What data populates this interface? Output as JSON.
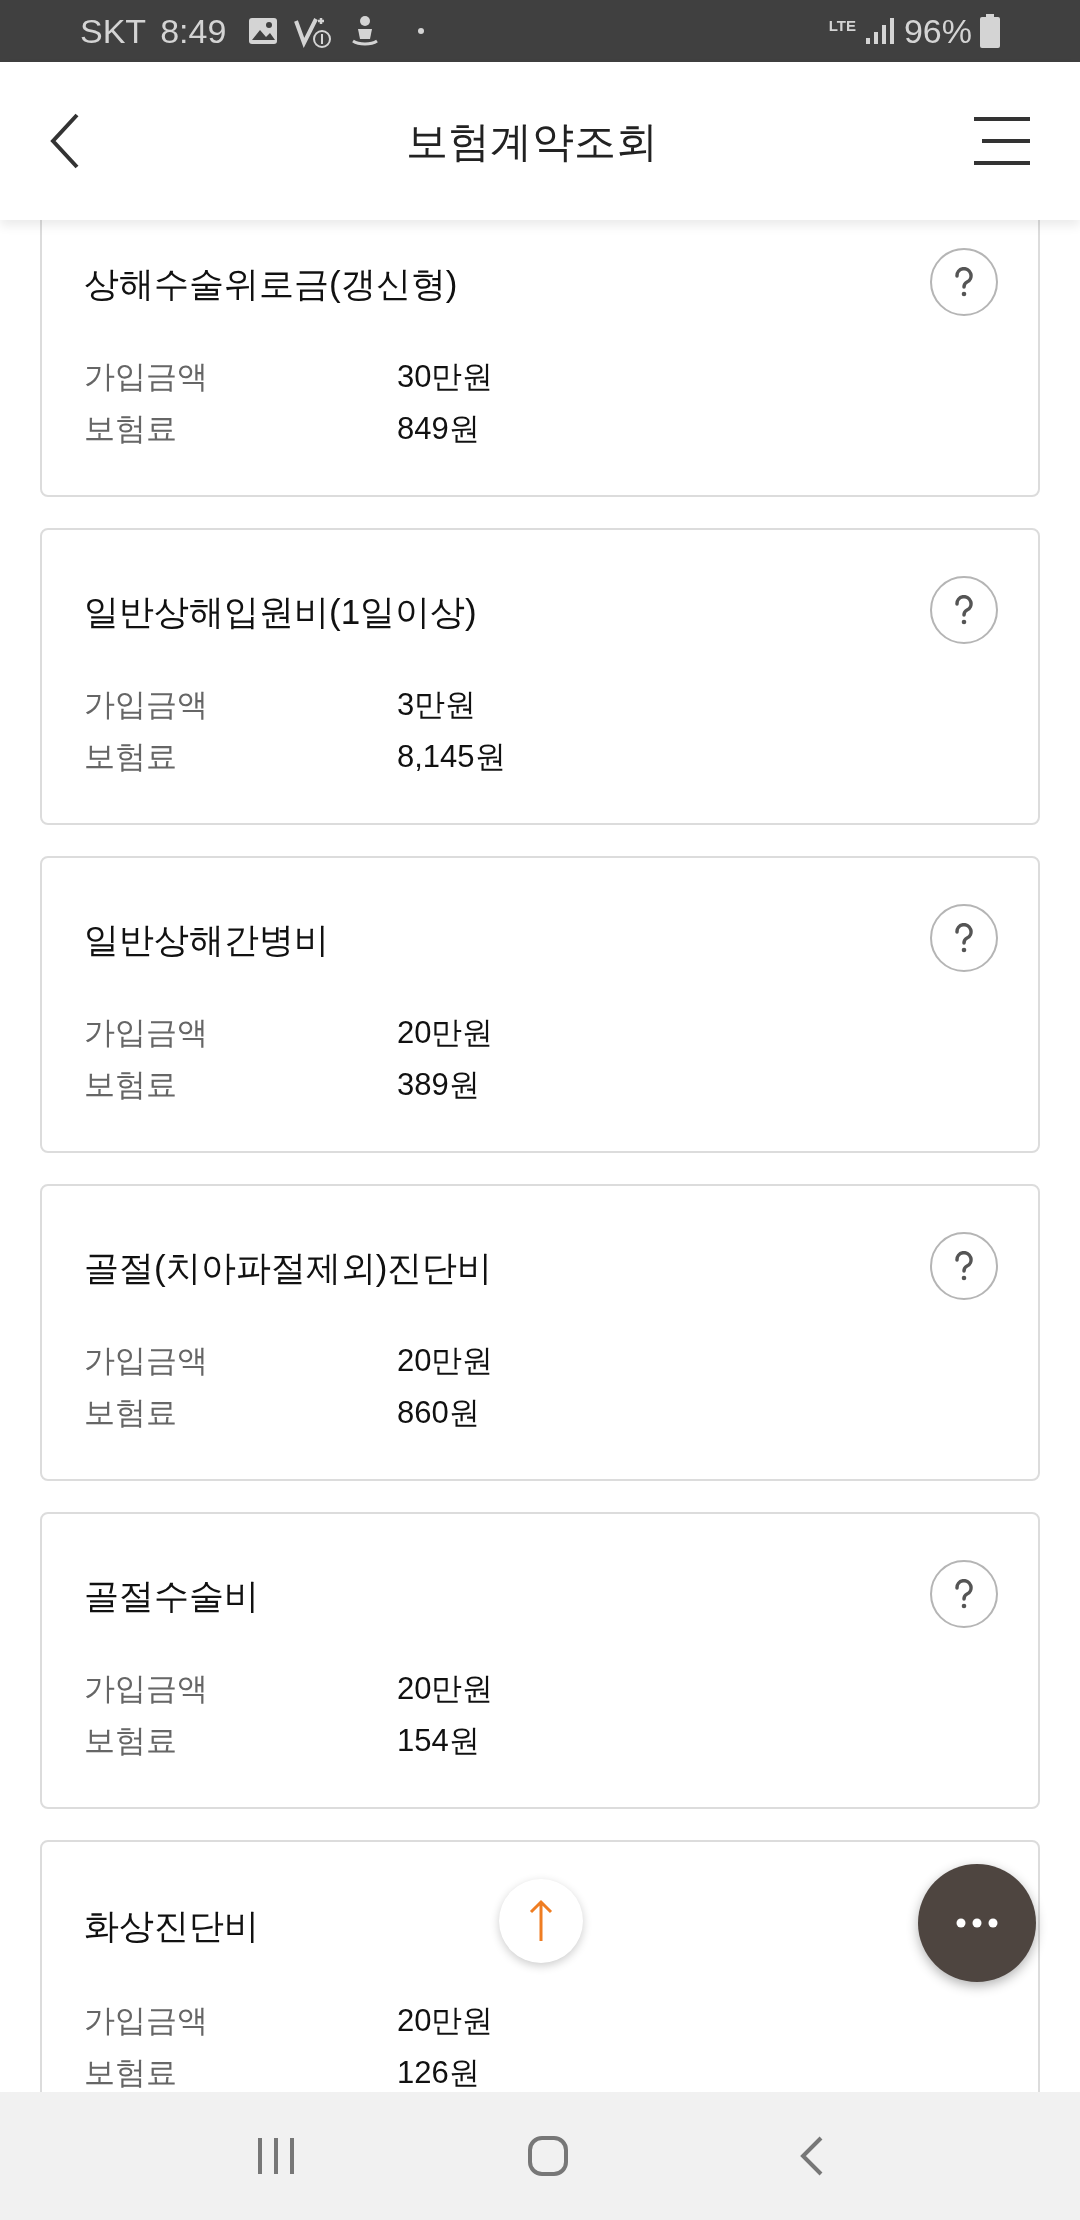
{
  "status_bar": {
    "carrier": "SKT",
    "time": "8:49",
    "network": "LTE",
    "battery": "96%"
  },
  "header": {
    "title": "보험계약조회"
  },
  "cards": [
    {
      "title": "상해수술위로금(갱신형)",
      "rows": [
        {
          "label": "가입금액",
          "value": "30만원"
        },
        {
          "label": "보험료",
          "value": "849원"
        }
      ]
    },
    {
      "title": "일반상해입원비(1일이상)",
      "rows": [
        {
          "label": "가입금액",
          "value": "3만원"
        },
        {
          "label": "보험료",
          "value": "8,145원"
        }
      ]
    },
    {
      "title": "일반상해간병비",
      "rows": [
        {
          "label": "가입금액",
          "value": "20만원"
        },
        {
          "label": "보험료",
          "value": "389원"
        }
      ]
    },
    {
      "title": "골절(치아파절제외)진단비",
      "rows": [
        {
          "label": "가입금액",
          "value": "20만원"
        },
        {
          "label": "보험료",
          "value": "860원"
        }
      ]
    },
    {
      "title": "골절수술비",
      "rows": [
        {
          "label": "가입금액",
          "value": "20만원"
        },
        {
          "label": "보험료",
          "value": "154원"
        }
      ]
    },
    {
      "title": "화상진단비",
      "rows": [
        {
          "label": "가입금액",
          "value": "20만원"
        },
        {
          "label": "보험료",
          "value": "126원"
        }
      ]
    }
  ]
}
